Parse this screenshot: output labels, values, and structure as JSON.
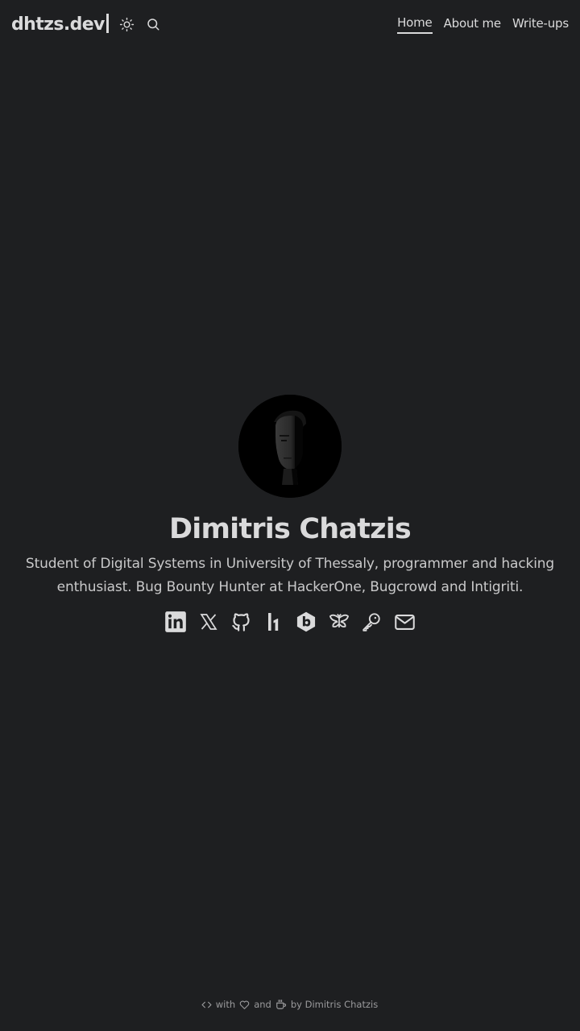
{
  "header": {
    "logo": "dhtzs.dev",
    "theme_toggle_icon": "sun-icon",
    "search_icon": "search-icon",
    "nav": [
      {
        "label": "Home",
        "active": true
      },
      {
        "label": "About me",
        "active": false
      },
      {
        "label": "Write-ups",
        "active": false
      }
    ]
  },
  "profile": {
    "name": "Dimitris Chatzis",
    "bio": "Student of Digital Systems in University of Thessaly, programmer and hacking enthusiast. Bug Bounty Hunter at HackerOne, Bugcrowd and Intigriti.",
    "social_icons": [
      "linkedin-icon",
      "x-icon",
      "github-icon",
      "hackerone-icon",
      "bugcrowd-icon",
      "intigriti-icon",
      "key-icon",
      "email-icon"
    ]
  },
  "footer": {
    "with": "with",
    "and": "and",
    "by": "by Dimitris Chatzis"
  },
  "colors": {
    "background": "#1e1f21",
    "text": "#dadadb"
  }
}
